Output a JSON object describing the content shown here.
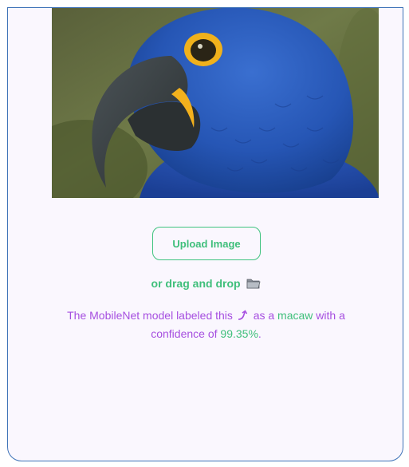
{
  "upload": {
    "button_label": "Upload Image",
    "drag_text": "or drag and drop",
    "folder_icon": "folder-icon"
  },
  "result": {
    "prefix": "The MobileNet model labeled this",
    "arrow_icon": "arrow-up-right-icon",
    "mid": "as a",
    "label": "macaw",
    "mid2": "with a confidence of",
    "confidence": "99.35%",
    "suffix": "."
  },
  "colors": {
    "frame_border": "#3f73b8",
    "background": "#faf7fe",
    "accent_green": "#3fbf7b",
    "accent_purple": "#a64fe0"
  }
}
